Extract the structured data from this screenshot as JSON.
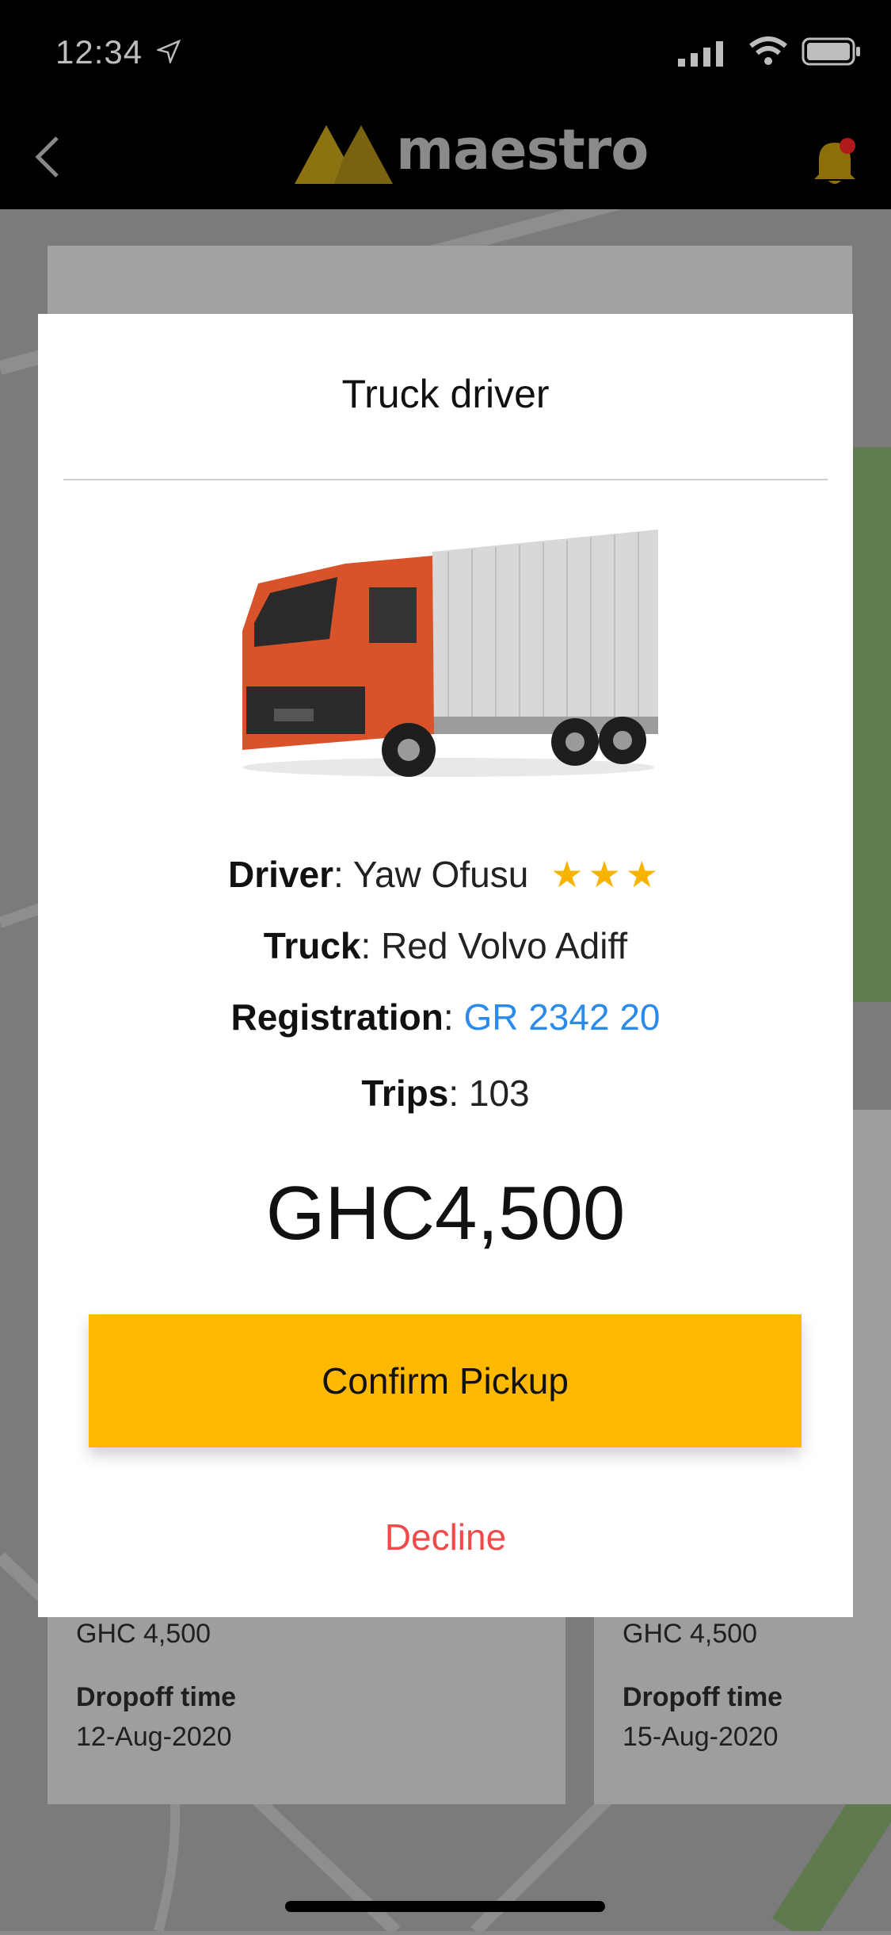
{
  "status_bar": {
    "time": "12:34"
  },
  "navbar": {
    "brand": "maestro"
  },
  "background_cards": [
    {
      "price": "GHC 4,500",
      "dropoff_label": "Dropoff time",
      "dropoff_date": "12-Aug-2020"
    },
    {
      "price": "GHC 4,500",
      "dropoff_label": "Dropoff time",
      "dropoff_date": "15-Aug-2020"
    }
  ],
  "modal": {
    "title": "Truck driver",
    "driver_label": "Driver",
    "driver_name": "Yaw Ofusu",
    "rating_stars": 3,
    "truck_label": "Truck",
    "truck_name": "Red Volvo Adiff",
    "registration_label": "Registration",
    "registration_value": "GR 2342 20",
    "trips_label": "Trips",
    "trips_value": "103",
    "price": "GHC4,500",
    "confirm_label": "Confirm Pickup",
    "decline_label": "Decline"
  },
  "colors": {
    "accent": "#ffb900",
    "link": "#2c8bea",
    "danger": "#f04a4a"
  }
}
